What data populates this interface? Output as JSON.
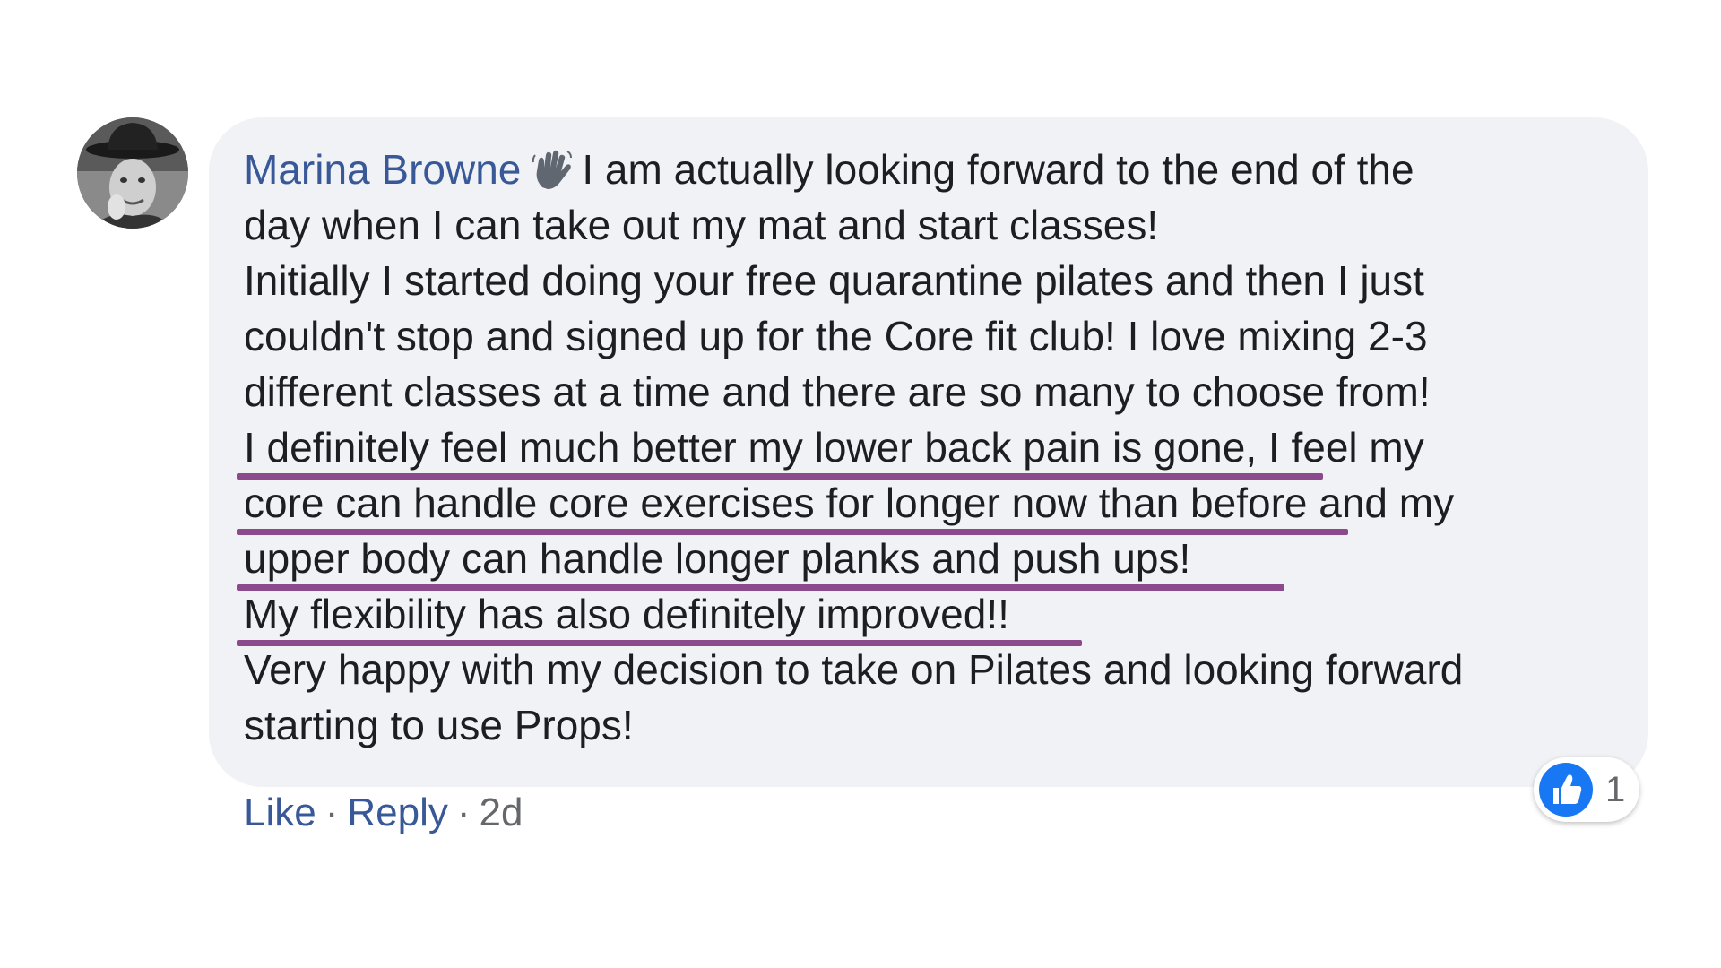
{
  "comment": {
    "author": "Marina Browne",
    "author_icon": "waving-hand-icon",
    "lines": [
      "I am actually looking forward to the end of the",
      "day when I can take out my mat and start classes!",
      "Initially I started doing your free quarantine pilates and then I just",
      "couldn't stop and signed up for the Core fit club! I love mixing 2-3",
      "different classes at a time and there are so many to choose from!",
      "I definitely feel much better my lower back pain is gone, I feel my",
      "core can handle core exercises for longer now than before and my",
      "upper body can handle longer planks and push ups!",
      "My flexibility has also definitely improved!!",
      "Very happy with my decision to take on Pilates and looking forward",
      "starting to use Props!"
    ],
    "highlight_color": "#8b4a8b"
  },
  "actions": {
    "like_label": "Like",
    "separator": "·",
    "reply_label": "Reply",
    "timestamp": "2d"
  },
  "reactions": {
    "icon": "thumbs-up-icon",
    "count": "1"
  },
  "colors": {
    "bubble": "#f0f2f5",
    "link": "#385898",
    "text": "#1c1e21",
    "meta": "#65676b",
    "like_blue": "#1877f2"
  }
}
